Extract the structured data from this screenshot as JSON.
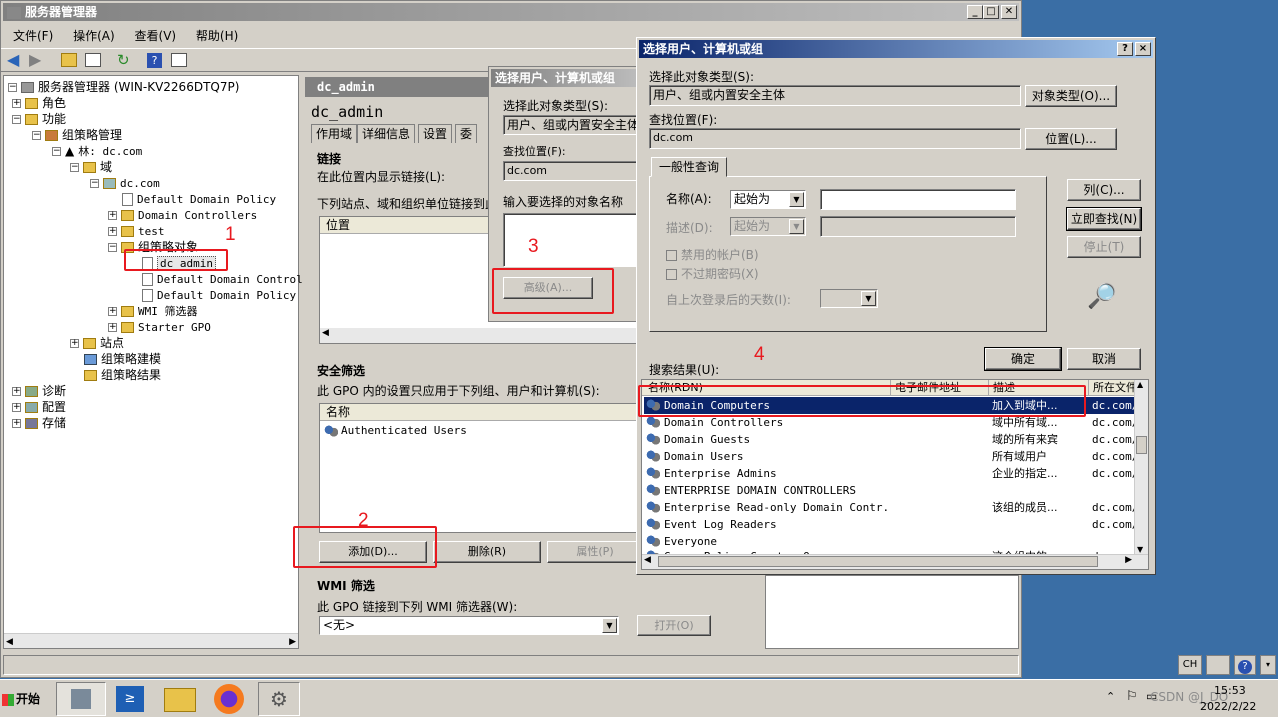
{
  "main_window": {
    "title": "服务器管理器",
    "menu": [
      "文件(F)",
      "操作(A)",
      "查看(V)",
      "帮助(H)"
    ],
    "status": ""
  },
  "tree": {
    "items": [
      "服务器管理器 (WIN-KV2266DTQ7P)",
      "角色",
      "功能",
      "组策略管理",
      "林: dc.com",
      "域",
      "dc.com",
      "Default Domain Policy",
      "Domain Controllers",
      "test",
      "组策略对象",
      "dc_admin",
      "Default Domain Controll",
      "Default Domain Policy",
      "WMI 筛选器",
      "Starter GPO",
      "站点",
      "组策略建模",
      "组策略结果",
      "诊断",
      "配置",
      "存储"
    ]
  },
  "gpo": {
    "header": "dc_admin",
    "title": "dc_admin",
    "tabs": [
      "作用域",
      "详细信息",
      "设置",
      "委"
    ],
    "links_heading": "链接",
    "links_label": "在此位置内显示链接(L):",
    "links_desc": "下列站点、域和组织单位链接到此",
    "links_column": "位置",
    "security_heading": "安全筛选",
    "security_desc": "此 GPO 内的设置只应用于下列组、用户和计算机(S):",
    "security_column": "名称",
    "security_entry": "Authenticated Users",
    "add_button": "添加(D)...",
    "remove_button": "删除(R)",
    "properties_button": "属性(P)",
    "wmi_heading": "WMI 筛选",
    "wmi_desc": "此 GPO 链接到下列 WMI 筛选器(W):",
    "wmi_value": "<无>",
    "open_button": "打开(O)"
  },
  "bg_dialog": {
    "title": "选择用户、计算机或组",
    "object_type_label": "选择此对象类型(S):",
    "object_type_value": "用户、组或内置安全主体",
    "location_label": "查找位置(F):",
    "location_value": "dc.com",
    "enter_names_label": "输入要选择的对象名称",
    "advanced_button": "高级(A)..."
  },
  "dialog": {
    "title": "选择用户、计算机或组",
    "help_btn": "?",
    "close_btn": "×",
    "object_type_label": "选择此对象类型(S):",
    "object_type_value": "用户、组或内置安全主体",
    "object_type_button": "对象类型(O)...",
    "location_label": "查找位置(F):",
    "location_value": "dc.com",
    "location_button": "位置(L)...",
    "tab": "一般性查询",
    "name_label": "名称(A):",
    "name_mode": "起始为",
    "desc_label": "描述(D):",
    "desc_mode": "起始为",
    "disabled_accounts": "禁用的帐户(B)",
    "non_expiring": "不过期密码(X)",
    "days_since_logon": "自上次登录后的天数(I):",
    "columns_button": "列(C)...",
    "find_now_button": "立即查找(N)",
    "stop_button": "停止(T)",
    "ok_button": "确定",
    "cancel_button": "取消",
    "results_label": "搜索结果(U):",
    "result_columns": [
      "名称(RDN)",
      "电子邮件地址",
      "描述",
      "所在文件"
    ],
    "results": [
      {
        "name": "Domain Computers",
        "email": "",
        "desc": "加入到域中...",
        "folder": "dc.com/U"
      },
      {
        "name": "Domain Controllers",
        "email": "",
        "desc": "域中所有域...",
        "folder": "dc.com/U"
      },
      {
        "name": "Domain Guests",
        "email": "",
        "desc": "域的所有来宾",
        "folder": "dc.com/U"
      },
      {
        "name": "Domain Users",
        "email": "",
        "desc": "所有域用户",
        "folder": "dc.com/U"
      },
      {
        "name": "Enterprise Admins",
        "email": "",
        "desc": "企业的指定...",
        "folder": "dc.com/U"
      },
      {
        "name": "ENTERPRISE DOMAIN CONTROLLERS",
        "email": "",
        "desc": "",
        "folder": ""
      },
      {
        "name": "Enterprise Read-only Domain Contr...",
        "email": "",
        "desc": "该组的成员...",
        "folder": "dc.com/U"
      },
      {
        "name": "Event Log Readers",
        "email": "",
        "desc": "",
        "folder": "dc.com/B"
      },
      {
        "name": "Everyone",
        "email": "",
        "desc": "",
        "folder": ""
      },
      {
        "name": "Group Policy Creator Owners",
        "email": "",
        "desc": "这个组中的...",
        "folder": "dc.com/U"
      }
    ]
  },
  "annotations": [
    "1",
    "2",
    "3",
    "4"
  ],
  "taskbar": {
    "start": "开始",
    "lang": "CH",
    "time": "15:53",
    "date": "2022/2/22",
    "watermark": "CSDN @J_DO"
  },
  "colors": {
    "annotation": "#e8191f",
    "selection": "#0a246a",
    "desktop": "#3a6ea5"
  }
}
